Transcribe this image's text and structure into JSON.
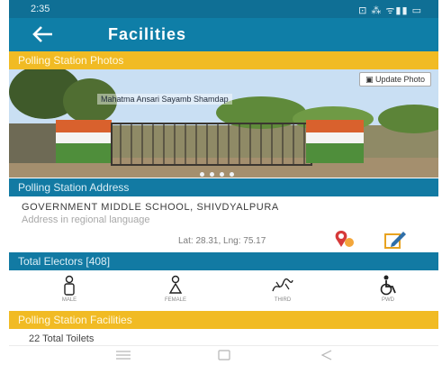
{
  "status_bar": {
    "time": "2:35",
    "right_icons": "⊡ ⁂ ᯤ▮▮ ▭"
  },
  "app_bar": {
    "title": "Facilities"
  },
  "sections": {
    "photos": "Polling Station Photos",
    "address": "Polling Station Address",
    "electors": "Total Electors [408]",
    "facilities": "Polling Station Facilities"
  },
  "photo": {
    "update_label": "Update Photo",
    "caption": "Mahatma Ansari Sayamb Shamdap"
  },
  "address": {
    "line1": "GOVERNMENT MIDDLE SCHOOL, SHIVDYALPURA",
    "line2": "Address in regional language",
    "latlng": "Lat: 28.31, Lng: 75.17"
  },
  "electors": {
    "labels": [
      "MALE",
      "FEMALE",
      "THIRD",
      "PWD"
    ]
  },
  "facilities": {
    "first_item": "22 Total Toilets"
  },
  "colors": {
    "primary": "#0f7ea7",
    "accent_yellow": "#f1bb24",
    "status": "#0f6f95"
  },
  "icons": [
    "back-arrow-icon",
    "camera-icon",
    "map-pin-icon",
    "edit-icon",
    "male-icon",
    "female-icon",
    "third-gender-icon",
    "wheelchair-icon"
  ]
}
